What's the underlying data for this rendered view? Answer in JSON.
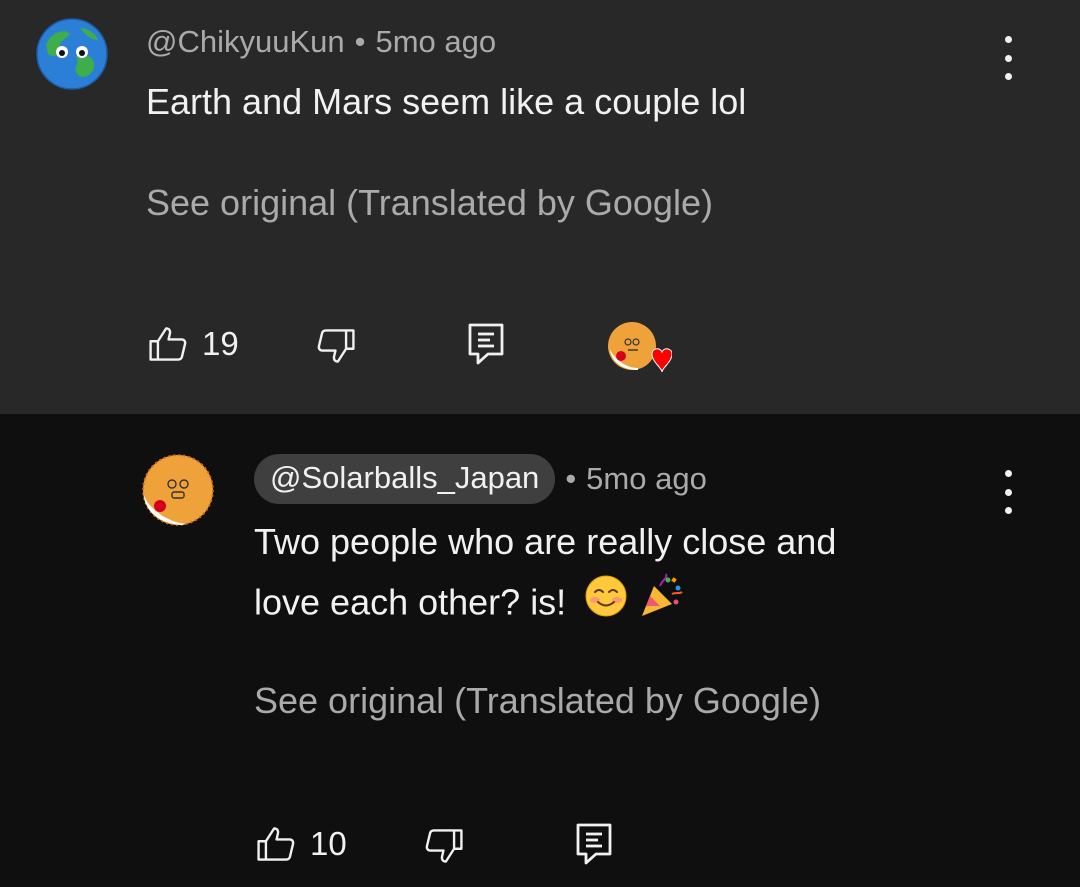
{
  "comment": {
    "handle": "@ChikyuuKun",
    "separator": "•",
    "time": "5mo ago",
    "text": "Earth and Mars seem like a couple lol",
    "see_original": "See original (Translated by Google)",
    "like_count": "19",
    "avatar_icon": "earth-ball-avatar",
    "creator_heart_icon": "creator-heart-avatar",
    "menu_icon": "more-vert-icon"
  },
  "reply": {
    "handle": "@Solarballs_Japan",
    "separator": "•",
    "time": "5mo ago",
    "text_line1": "Two people who are really close and",
    "text_line2": "love each other? is!",
    "emojis": [
      "smiling-face-emoji",
      "party-popper-emoji"
    ],
    "see_original": "See original (Translated by Google)",
    "like_count": "10",
    "avatar_icon": "sun-japan-ball-avatar",
    "menu_icon": "more-vert-icon"
  },
  "colors": {
    "comment_bg": "#282828",
    "reply_bg": "#0f0f0f",
    "primary_text": "#f1f1f1",
    "secondary_text": "#aaaaaa",
    "chip_bg": "#3f3f3f",
    "heart": "#ff0000"
  }
}
